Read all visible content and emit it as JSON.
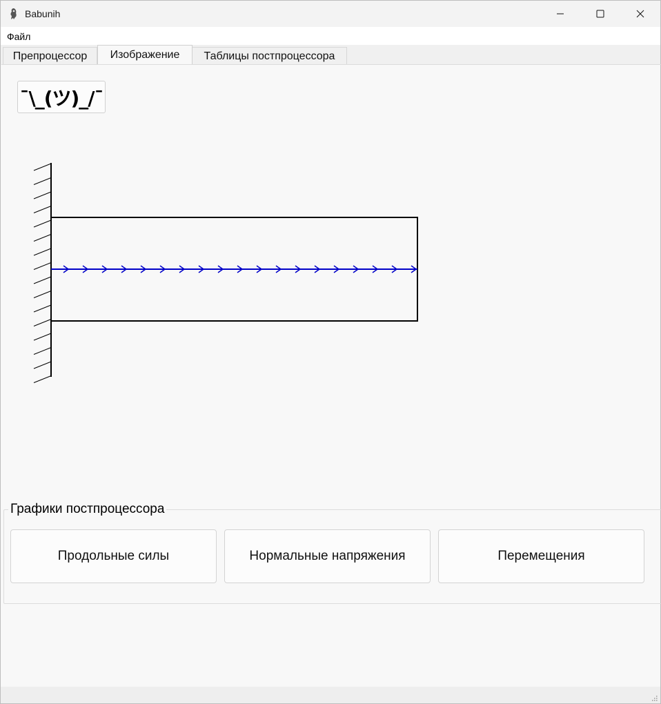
{
  "window": {
    "title": "Babunih",
    "controls": {
      "minimize": "minimize",
      "maximize": "maximize",
      "close": "close"
    }
  },
  "menu": {
    "items": [
      "Файл"
    ]
  },
  "tabs": [
    {
      "label": "Препроцессор",
      "active": false
    },
    {
      "label": "Изображение",
      "active": true
    },
    {
      "label": "Таблицы постпроцессора",
      "active": false
    }
  ],
  "shrug_button": {
    "label": "¯\\_(ツ)_/¯"
  },
  "drawing": {
    "support": "fixed-wall-left",
    "rod_count": 1,
    "distributed_load_direction": "right",
    "load_color": "#0000c8",
    "arrow_count": 19
  },
  "postprocessor_charts": {
    "title": "Графики постпроцессора",
    "buttons": [
      {
        "label": "Продольные силы"
      },
      {
        "label": "Нормальные напряжения"
      },
      {
        "label": "Перемещения"
      }
    ]
  }
}
